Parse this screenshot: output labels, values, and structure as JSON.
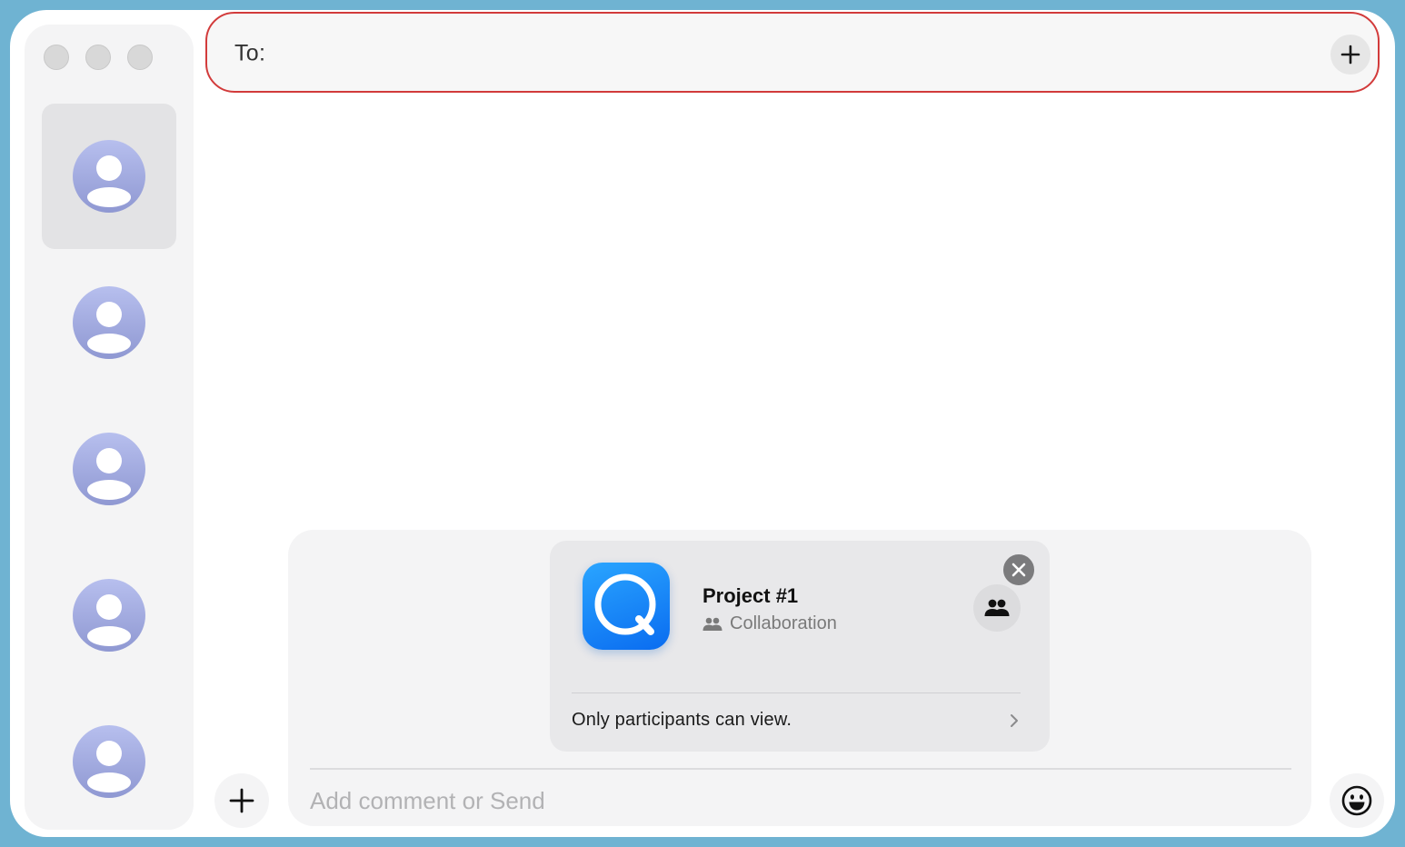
{
  "to_bar": {
    "label": "To:",
    "add_icon": "plus-icon"
  },
  "sidebar": {
    "window_controls": [
      "close",
      "minimize",
      "zoom"
    ],
    "conversations": [
      {
        "avatar": "person-avatar-icon",
        "selected": true
      },
      {
        "avatar": "person-avatar-icon",
        "selected": false
      },
      {
        "avatar": "person-avatar-icon",
        "selected": false
      },
      {
        "avatar": "person-avatar-icon",
        "selected": false
      },
      {
        "avatar": "person-avatar-icon",
        "selected": false
      }
    ]
  },
  "share_card": {
    "title": "Project #1",
    "subtitle": "Collaboration",
    "footer": "Only participants can view.",
    "app_icon": "quick-app-icon",
    "close_icon": "close-icon",
    "collab_icon": "people-icon",
    "chevron_icon": "chevron-right-icon"
  },
  "compose": {
    "placeholder": "Add comment or Send",
    "value": ""
  },
  "colors": {
    "accent_outline": "#d23b3b",
    "app_icon_blue": "#0a6cf0",
    "avatar": "#a3aee0",
    "backdrop": "#6fb3d2"
  }
}
